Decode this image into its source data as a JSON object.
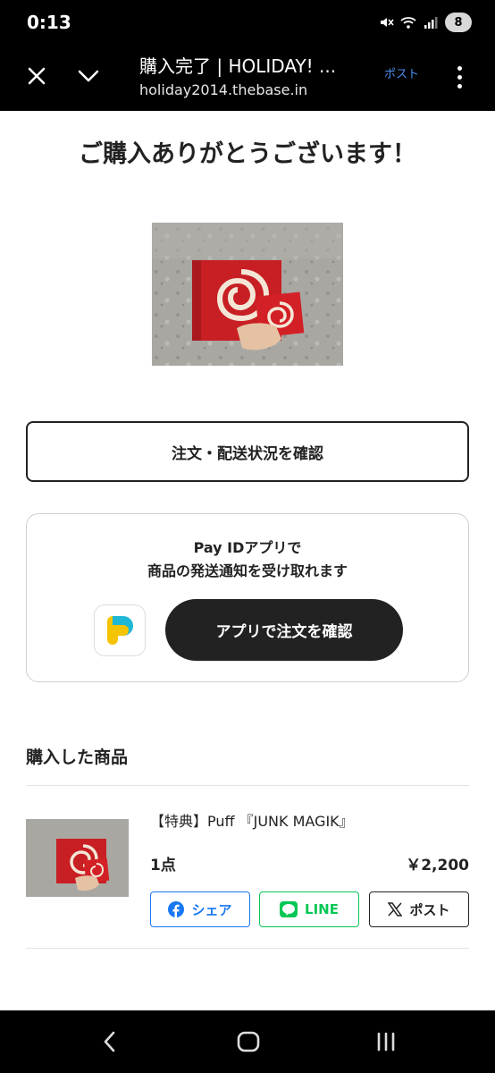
{
  "status_bar": {
    "time": "0:13",
    "battery_level": "8",
    "icons": [
      "mute-icon",
      "wifi-icon",
      "signal-icon",
      "battery-icon"
    ]
  },
  "browser": {
    "title": "購入完了 | HOLIDAY! ...",
    "url": "holiday2014.thebase.in",
    "post_label": "ポスト",
    "icons": [
      "close-icon",
      "chevron-down-icon",
      "more-vert-icon"
    ]
  },
  "page": {
    "heading": "ご購入ありがとうございます！",
    "order_status_button": "注文・配送状況を確認",
    "payid": {
      "line1": "Pay IDアプリで",
      "line2": "商品の発送通知を受け取れます",
      "app_button": "アプリで注文を確認"
    },
    "purchased_section_title": "購入した商品",
    "product": {
      "name": "【特典】Puff 『JUNK MAGIK』",
      "quantity": "1点",
      "price": "￥2,200"
    },
    "share": {
      "facebook": "シェア",
      "line": "LINE",
      "x": "ポスト"
    }
  },
  "colors": {
    "facebook": "#1877f2",
    "line": "#06c755",
    "dark_button": "#222222",
    "payid_yellow": "#f5c400",
    "payid_teal": "#1fb7d6"
  }
}
